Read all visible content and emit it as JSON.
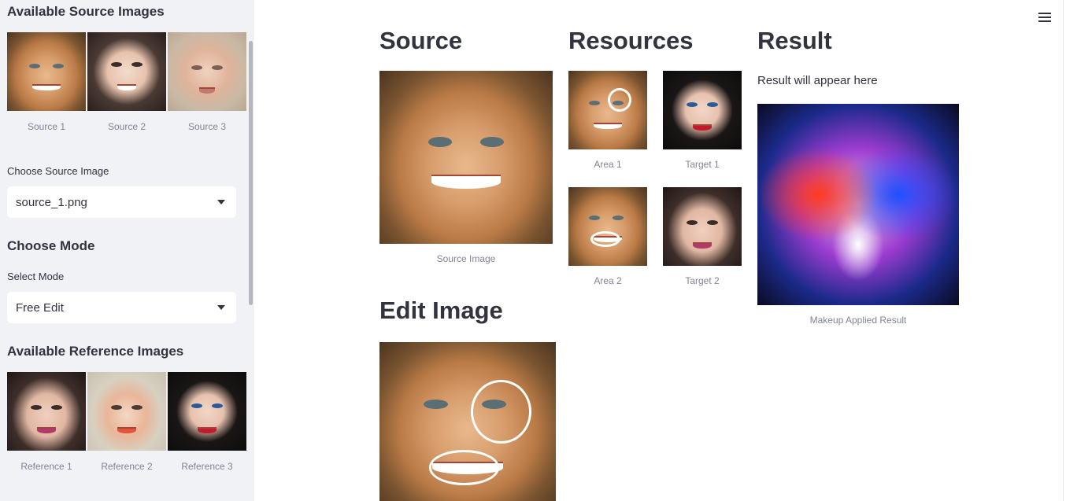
{
  "sidebar": {
    "available_source_title": "Available Source Images",
    "source_captions": [
      "Source 1",
      "Source 2",
      "Source 3"
    ],
    "choose_source_label": "Choose Source Image",
    "choose_source_value": "source_1.png",
    "choose_mode_title": "Choose Mode",
    "select_mode_label": "Select Mode",
    "select_mode_value": "Free Edit",
    "available_ref_title": "Available Reference Images",
    "reference_captions": [
      "Reference 1",
      "Reference 2",
      "Reference 3"
    ]
  },
  "main": {
    "source_title": "Source",
    "source_caption": "Source Image",
    "resources_title": "Resources",
    "resource_captions": [
      "Area 1",
      "Target 1",
      "Area 2",
      "Target 2"
    ],
    "result_title": "Result",
    "result_placeholder": "Result will appear here",
    "result_caption": "Makeup Applied Result",
    "edit_title": "Edit Image"
  },
  "icons": {
    "menu": "hamburger-menu-icon",
    "caret": "chevron-down-icon"
  },
  "colors": {
    "sidebar_bg": "#f0f2f6",
    "text": "#31333f",
    "caption": "#808495"
  }
}
